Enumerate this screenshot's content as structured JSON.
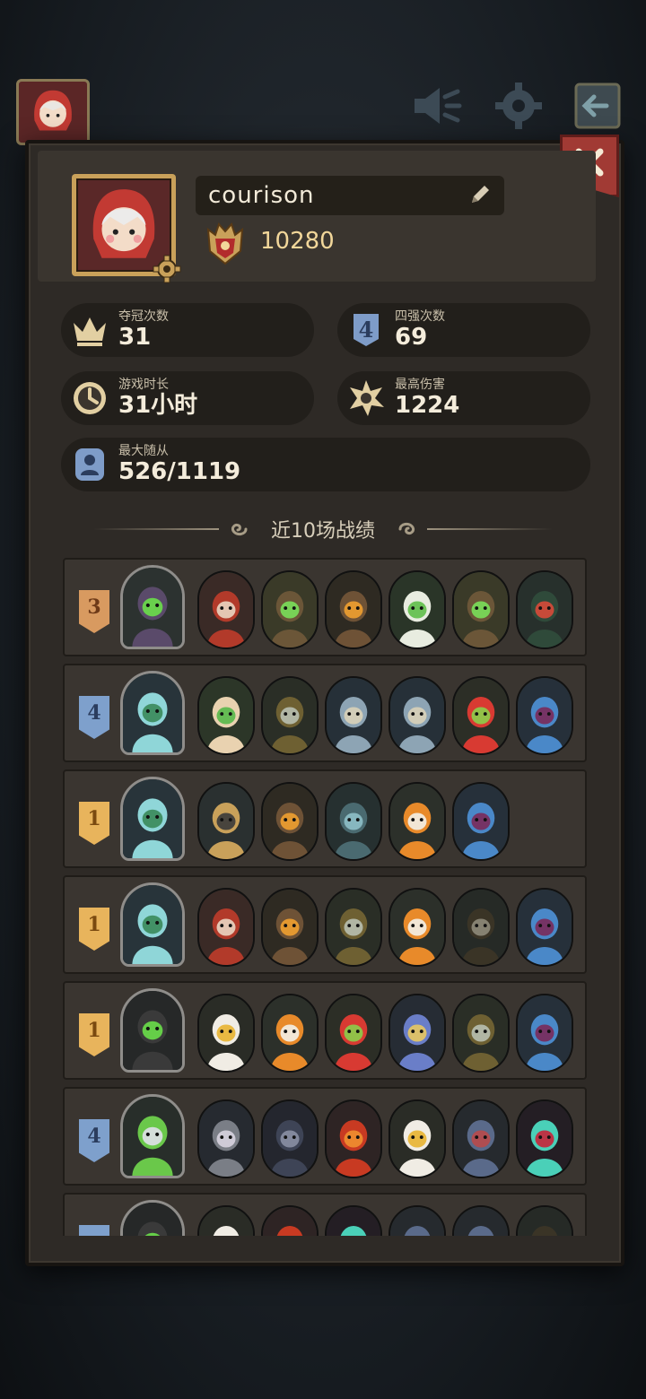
{
  "profile": {
    "name": "courison",
    "trophies": "10280"
  },
  "stats": [
    {
      "label": "夺冠次数",
      "value": "31",
      "icon": "crown-icon"
    },
    {
      "label": "四强次数",
      "value": "69",
      "icon": "top4-badge-icon"
    },
    {
      "label": "游戏时长",
      "value": "31小时",
      "icon": "clock-icon"
    },
    {
      "label": "最高伤害",
      "value": "1224",
      "icon": "damage-burst-icon"
    },
    {
      "label": "最大随从",
      "value": "526/1119",
      "icon": "minion-icon"
    }
  ],
  "section_title": "近10场战绩",
  "matches": [
    {
      "rank": "3",
      "tier": "bronze",
      "hero": "scarecrow-hero",
      "units": [
        "red-hood-assassin",
        "treant",
        "wooden-golem",
        "radish-ghost",
        "treant",
        "grinning-plant"
      ]
    },
    {
      "rank": "4",
      "tier": "blue",
      "hero": "fairy-queen-hero",
      "units": [
        "leaf-sprout",
        "witch-hat",
        "mushroom-crab",
        "mushroom-crab",
        "tomato-demon",
        "naga-siren"
      ]
    },
    {
      "rank": "1",
      "tier": "gold",
      "hero": "fairy-queen-hero",
      "units": [
        "armored-knight",
        "wooden-golem",
        "steam-robot",
        "pumpkin-ghost",
        "naga-siren"
      ]
    },
    {
      "rank": "1",
      "tier": "gold",
      "hero": "fairy-queen-hero",
      "units": [
        "red-hood-assassin",
        "wooden-golem",
        "witch-hat",
        "pumpkin-ghost",
        "scythe-reaper",
        "naga-siren"
      ]
    },
    {
      "rank": "1",
      "tier": "gold",
      "hero": "shadow-cat-hero",
      "units": [
        "griffin",
        "pumpkin-ghost",
        "tomato-demon",
        "paladin",
        "witch-hat",
        "naga-siren"
      ]
    },
    {
      "rank": "4",
      "tier": "blue",
      "hero": "fat-noble-hero",
      "units": [
        "gray-dragon",
        "werewolf",
        "fire-imp",
        "griffin",
        "bat-demon",
        "spirit-ghost"
      ]
    },
    {
      "rank": "",
      "tier": "blue",
      "hero": "shadow-cat-hero",
      "units": [
        "griffin",
        "fire-imp",
        "spirit-ghost",
        "bat-demon",
        "bat-demon",
        "scythe-reaper"
      ]
    }
  ],
  "colors": {
    "panel": "#2e2a26",
    "gold_rank": "#e8b45c",
    "bronze_rank": "#d89a60",
    "blue_rank": "#7ea0cc",
    "close_button": "#a13a34"
  }
}
